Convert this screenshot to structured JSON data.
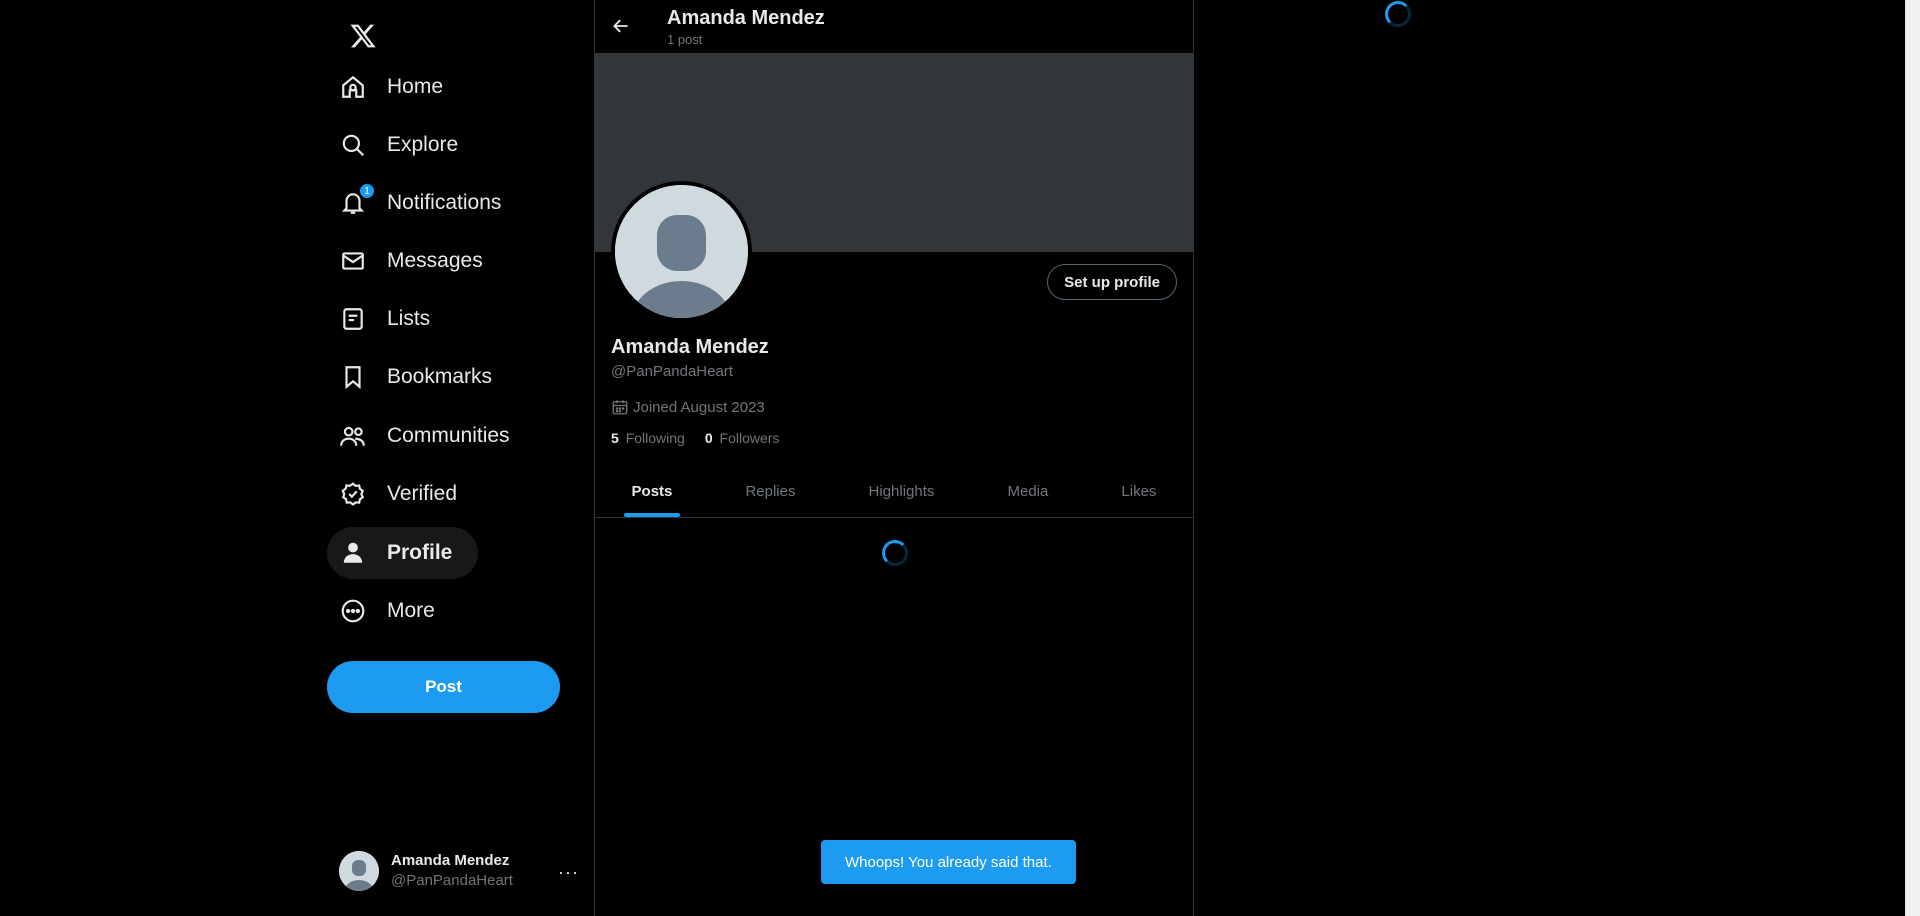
{
  "nav": {
    "items": [
      {
        "label": "Home",
        "icon": "home-icon"
      },
      {
        "label": "Explore",
        "icon": "search-icon"
      },
      {
        "label": "Notifications",
        "icon": "bell-icon",
        "badge": "1"
      },
      {
        "label": "Messages",
        "icon": "envelope-icon"
      },
      {
        "label": "Lists",
        "icon": "list-icon"
      },
      {
        "label": "Bookmarks",
        "icon": "bookmark-icon"
      },
      {
        "label": "Communities",
        "icon": "communities-icon"
      },
      {
        "label": "Verified",
        "icon": "verified-icon"
      },
      {
        "label": "Profile",
        "icon": "person-icon"
      },
      {
        "label": "More",
        "icon": "more-circle-icon"
      }
    ],
    "post_label": "Post"
  },
  "account": {
    "name": "Amanda Mendez",
    "handle": "@PanPandaHeart",
    "more": "···"
  },
  "header": {
    "name": "Amanda Mendez",
    "post_count": "1 post"
  },
  "profile": {
    "name": "Amanda Mendez",
    "handle": "@PanPandaHeart",
    "joined": "Joined August 2023",
    "following_count": "5",
    "following_label": "Following",
    "followers_count": "0",
    "followers_label": "Followers",
    "setup_label": "Set up profile"
  },
  "tabs": [
    "Posts",
    "Replies",
    "Highlights",
    "Media",
    "Likes"
  ],
  "toast": "Whoops! You already said that.",
  "colors": {
    "accent": "#1d9bf0",
    "background": "#000000",
    "banner": "#333639"
  }
}
